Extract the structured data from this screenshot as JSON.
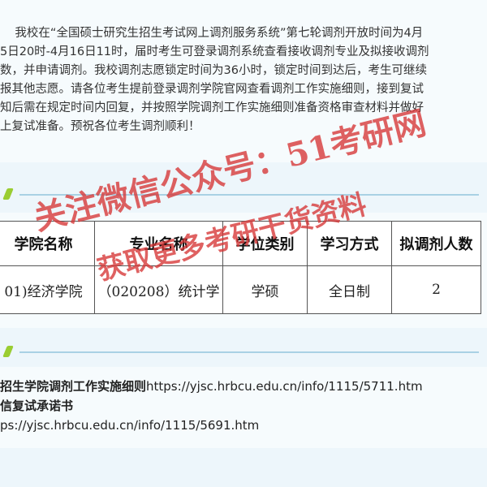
{
  "intro": {
    "text": "    我校在“全国硕士研究生招生考试网上调剂服务系统”第七轮调剂开放时间为4月\n5日20时-4月16日11时，届时考生可登录调剂系统查看接收调剂专业及拟接收调剂\n数，并申请调剂。我校调剂志愿锁定时间为36小时，锁定时间到达后，考生可继续\n报其他志愿。请各位考生提前登录调剂学院官网查看调剂工作实施细则，接到复试\n知后需在规定时间内回复，并按照学院调剂工作实施细则准备资格审查材料并做好\n上复试准备。预祝各位考生调剂顺利！"
  },
  "table": {
    "headers": [
      "学院名称",
      "专业名称",
      "学位类别",
      "学习方式",
      "拟调剂人数"
    ],
    "rows": [
      [
        "01)经济学院",
        "（020208）统计学",
        "学硕",
        "全日制",
        "2"
      ]
    ]
  },
  "links": {
    "rules_label": "招生学院调剂工作实施细则",
    "rules_url": "https://yjsc.hrbcu.edu.cn/info/1115/5711.htm",
    "pledge_label": "信复试承诺书",
    "pledge_url": "ps://yjsc.hrbcu.edu.cn/info/1115/5691.htm"
  },
  "watermark": {
    "line1": "关注微信公众号：51考研网",
    "line2": "获取更多考研干货资料"
  },
  "colors": {
    "background": "#edf6fb",
    "accent": "#9acd32",
    "divider": "#a9d1e4",
    "watermark": "#d63434"
  }
}
